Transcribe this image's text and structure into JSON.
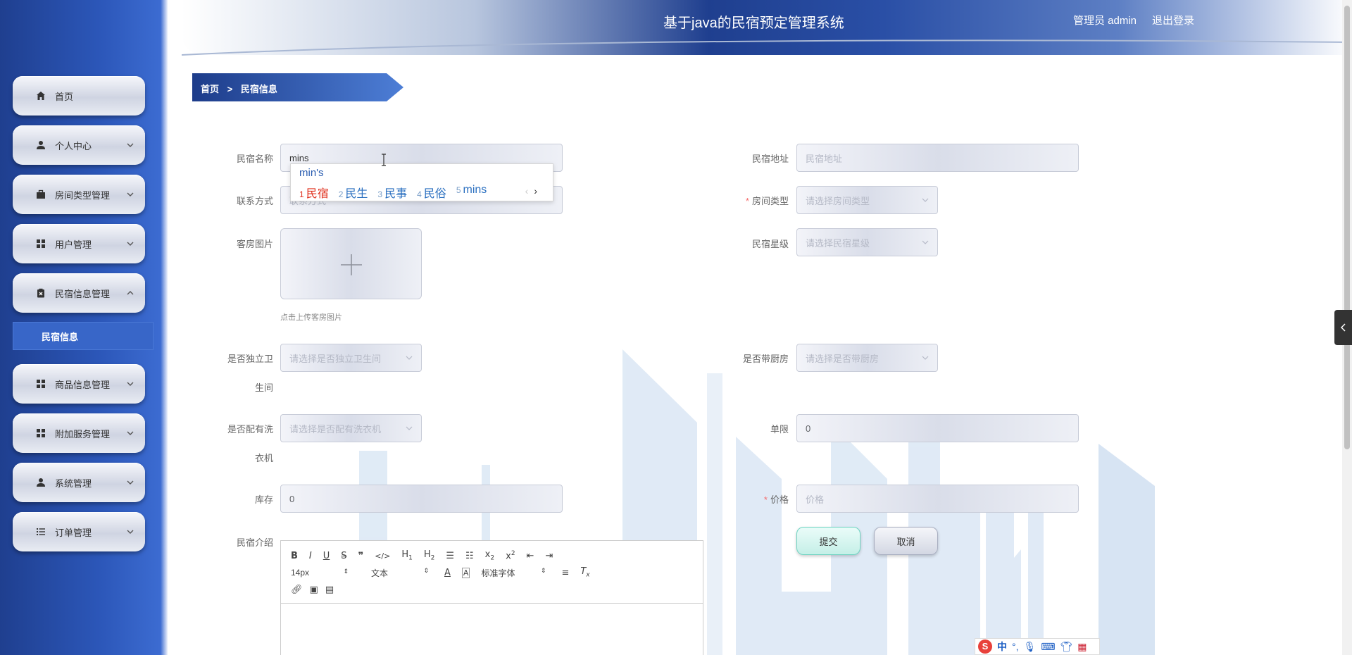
{
  "header": {
    "title": "基于java的民宿预定管理系统",
    "user_label": "管理员 admin",
    "logout_label": "退出登录"
  },
  "sidebar": {
    "items": [
      {
        "label": "首页",
        "icon": "home-icon",
        "has_chevron": false
      },
      {
        "label": "个人中心",
        "icon": "user-icon",
        "has_chevron": true
      },
      {
        "label": "房间类型管理",
        "icon": "briefcase-icon",
        "has_chevron": true
      },
      {
        "label": "用户管理",
        "icon": "grid-icon",
        "has_chevron": true
      },
      {
        "label": "民宿信息管理",
        "icon": "clipboard-x-icon",
        "has_chevron": true,
        "expanded": true
      },
      {
        "label": "商品信息管理",
        "icon": "grid-icon",
        "has_chevron": true
      },
      {
        "label": "附加服务管理",
        "icon": "grid-icon",
        "has_chevron": true
      },
      {
        "label": "系统管理",
        "icon": "user-icon",
        "has_chevron": true
      },
      {
        "label": "订单管理",
        "icon": "list-icon",
        "has_chevron": true
      }
    ],
    "submenu": {
      "label": "民宿信息"
    }
  },
  "breadcrumb": {
    "home": "首页",
    "separator": ">",
    "current": "民宿信息"
  },
  "form": {
    "name": {
      "label": "民宿名称",
      "value": "mins"
    },
    "address": {
      "label": "民宿地址",
      "placeholder": "民宿地址"
    },
    "contact": {
      "label": "联系方式",
      "placeholder": "联系方式"
    },
    "room_type": {
      "label": "房间类型",
      "required": true,
      "placeholder": "请选择房间类型"
    },
    "room_image": {
      "label": "客房图片",
      "hint": "点击上传客房图片"
    },
    "star": {
      "label": "民宿星级",
      "placeholder": "请选择民宿星级"
    },
    "bathroom": {
      "label_line1": "是否独立卫",
      "label_line2": "生间",
      "placeholder": "请选择是否独立卫生间"
    },
    "kitchen": {
      "label": "是否带厨房",
      "placeholder": "请选择是否带厨房"
    },
    "washer": {
      "label_line1": "是否配有洗",
      "label_line2": "衣机",
      "placeholder": "请选择是否配有洗衣机"
    },
    "limit": {
      "label": "单限",
      "value": "0"
    },
    "stock": {
      "label": "库存",
      "value": "0"
    },
    "price": {
      "label": "价格",
      "required": true,
      "placeholder": "价格"
    },
    "intro": {
      "label": "民宿介绍"
    },
    "submit_label": "提交",
    "cancel_label": "取消"
  },
  "editor": {
    "font_size": "14px",
    "text_style": "文本",
    "font_family": "标准字体"
  },
  "ime": {
    "composition": "min's",
    "candidates": [
      {
        "num": "1",
        "text": "民宿"
      },
      {
        "num": "2",
        "text": "民生"
      },
      {
        "num": "3",
        "text": "民事"
      },
      {
        "num": "4",
        "text": "民俗"
      },
      {
        "num": "5",
        "text": "mins"
      }
    ],
    "prev": "‹",
    "next": "›"
  },
  "ime_bar": {
    "mode": "中"
  }
}
